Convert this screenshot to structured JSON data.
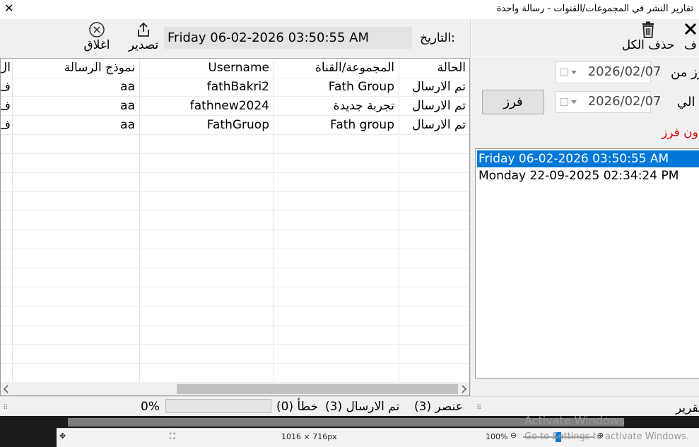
{
  "window": {
    "title": "تقارير النشر في المجموعات/القنوات -  رسالة واحدة",
    "close_glyph": "✕"
  },
  "toolbar": {
    "close_label": "اغلاق",
    "export_label": "تصدير",
    "date_label": "التاريخ:",
    "date_value": "Friday 06-02-2026 03:50:55 AM"
  },
  "right_toolbar": {
    "delete_all_label": "حذف الكل",
    "delete_one_label": "ف"
  },
  "table": {
    "columns": [
      "الحالة",
      "المجموعة/القناة",
      "Username",
      "نموذج الرسالة",
      "ال"
    ],
    "rows": [
      {
        "status": "تم الارسال",
        "group": "Fath Group",
        "username": "fathBakri2",
        "template": "aa",
        "extra": "ف"
      },
      {
        "status": "تم الارسال",
        "group": "تجربة جديدة",
        "username": "fathnew2024",
        "template": "aa",
        "extra": "ف"
      },
      {
        "status": "تم الارسال",
        "group": "Fath group",
        "username": "FathGruop",
        "template": "aa",
        "extra": "ف"
      }
    ]
  },
  "filter": {
    "from_label": "رز من",
    "to_label": "الي",
    "from_date": "2026/02/07",
    "to_date": "2026/02/07",
    "button_label": "فرز",
    "warning": "ون فرز"
  },
  "list": {
    "items": [
      "Friday 06-02-2026 03:50:55 AM",
      "Monday 22-09-2025 02:34:24 PM"
    ],
    "selected_index": 0
  },
  "status": {
    "count_text": "(3) عنصر",
    "sent_text": "(3) تم الارسال",
    "error_text": "(0) خطأ",
    "percent": "0%",
    "progress_fraction": 0,
    "right_label": "تقرير"
  },
  "editor_bar": {
    "size_text": "1016 × 716px",
    "zoom": "100%",
    "activate_line1": "Activate Windows",
    "activate_line2": "Go to Settings to activate Windows."
  },
  "colors": {
    "selection": "#0078d7",
    "warning": "#e00000"
  }
}
